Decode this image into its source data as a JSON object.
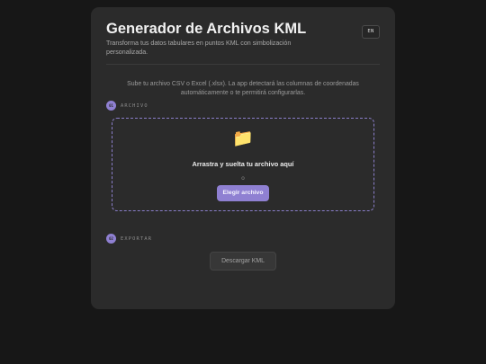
{
  "header": {
    "title": "Generador de Archivos KML",
    "subtitle": "Transforma tus datos tabulares en puntos KML con simbolización personalizada.",
    "language_button": "EN"
  },
  "intro": {
    "text": "Sube tu archivo CSV o Excel (.xlsx). La app detectará las columnas de coordenadas automáticamente o te permitirá configurarlas."
  },
  "steps": [
    {
      "number": "01",
      "label": "ARCHIVO"
    },
    {
      "number": "02",
      "label": "EXPORTAR"
    }
  ],
  "dropzone": {
    "icon": "folder-icon",
    "text": "Arrastra y suelta tu archivo aquí",
    "or_text": "o",
    "button_label": "Elegir archivo"
  },
  "export": {
    "download_label": "Descargar KML"
  },
  "colors": {
    "page_background": "#171717",
    "card_background": "#2b2b2b",
    "accent": "#8f80d2"
  }
}
